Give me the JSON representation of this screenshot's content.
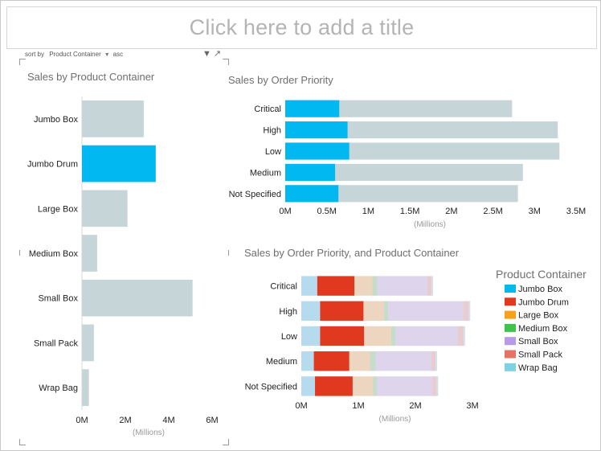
{
  "report": {
    "title_placeholder": "Click here to add a title",
    "sort_label": "sort by",
    "sort_field": "Product Container",
    "sort_dir": "asc"
  },
  "colors": {
    "highlight": "#01B8F0",
    "muted": "#C6D5D8"
  },
  "chart_data": [
    {
      "type": "bar",
      "orientation": "horizontal",
      "title": "Sales by Product Container",
      "categories": [
        "Jumbo Box",
        "Jumbo Drum",
        "Large Box",
        "Medium Box",
        "Small Box",
        "Small Pack",
        "Wrap Bag"
      ],
      "values": [
        2.85,
        3.4,
        2.1,
        0.7,
        5.1,
        0.55,
        0.32
      ],
      "highlighted": [
        false,
        true,
        false,
        false,
        false,
        false,
        false
      ],
      "xlim": [
        0,
        6
      ],
      "xticks": [
        "0M",
        "2M",
        "4M",
        "6M"
      ],
      "xunit": "(Millions)"
    },
    {
      "type": "bar",
      "orientation": "horizontal",
      "title": "Sales by Order Priority",
      "categories": [
        "Critical",
        "High",
        "Low",
        "Medium",
        "Not Specified"
      ],
      "total": [
        2.73,
        3.28,
        3.3,
        2.86,
        2.8
      ],
      "highlighted_values": [
        0.65,
        0.75,
        0.77,
        0.6,
        0.64
      ],
      "xlim": [
        0,
        3.5
      ],
      "xticks": [
        "0M",
        "0.5M",
        "1M",
        "1.5M",
        "2M",
        "2.5M",
        "3M",
        "3.5M"
      ],
      "xunit": "(Millions)"
    },
    {
      "type": "bar",
      "orientation": "horizontal",
      "stacked": true,
      "title": "Sales by Order Priority, and Product Container",
      "categories": [
        "Critical",
        "High",
        "Low",
        "Medium",
        "Not Specified"
      ],
      "xlim": [
        0,
        3
      ],
      "xticks": [
        "0M",
        "1M",
        "2M",
        "3M"
      ],
      "xunit": "(Millions)",
      "legend_title": "Product Container",
      "legend_position": "right",
      "series": [
        {
          "name": "Jumbo Box",
          "color": "#01B8F0",
          "values": [
            0.28,
            0.33,
            0.33,
            0.22,
            0.24
          ]
        },
        {
          "name": "Jumbo Drum",
          "color": "#E0391F",
          "values": [
            0.65,
            0.76,
            0.77,
            0.62,
            0.66
          ]
        },
        {
          "name": "Large Box",
          "color": "#F7A01C",
          "values": [
            0.32,
            0.36,
            0.48,
            0.37,
            0.36
          ]
        },
        {
          "name": "Medium Box",
          "color": "#3FC34A",
          "values": [
            0.08,
            0.07,
            0.07,
            0.09,
            0.06
          ]
        },
        {
          "name": "Small Box",
          "color": "#B79BE6",
          "values": [
            0.88,
            1.32,
            1.09,
            0.98,
            0.98
          ]
        },
        {
          "name": "Small Pack",
          "color": "#E57262",
          "values": [
            0.07,
            0.09,
            0.1,
            0.07,
            0.07
          ]
        },
        {
          "name": "Wrap Bag",
          "color": "#7ED1E1",
          "values": [
            0.03,
            0.03,
            0.03,
            0.03,
            0.03
          ]
        }
      ]
    }
  ]
}
